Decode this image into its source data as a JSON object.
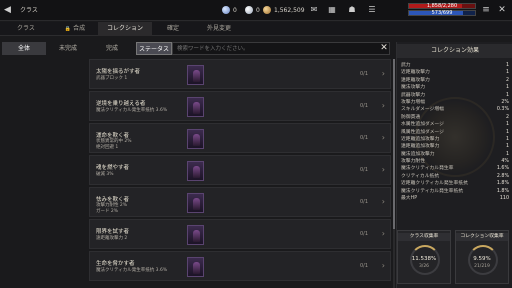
{
  "header": {
    "title": "クラス",
    "currency": [
      "0",
      "0",
      "1,562,509"
    ],
    "hp_text": "1,858/2,280",
    "hp_fraction": 0.81,
    "mp_text": "573/699",
    "mp_fraction": 0.82
  },
  "nav": {
    "tabs": [
      {
        "label": "クラス",
        "active": false
      },
      {
        "label": "合成",
        "active": false,
        "locked": true
      },
      {
        "label": "コレクション",
        "active": true
      },
      {
        "label": "確定",
        "active": false
      },
      {
        "label": "外見変更",
        "active": false
      }
    ]
  },
  "subtabs": {
    "items": [
      {
        "label": "全体",
        "state": "active"
      },
      {
        "label": "未完成",
        "state": ""
      },
      {
        "label": "完成",
        "state": ""
      },
      {
        "label": "ステータス",
        "state": "selected"
      }
    ],
    "search_placeholder": "検索ワードを入力ください。"
  },
  "collections": [
    {
      "title": "太陽を揺るがす者",
      "desc": [
        "武器ブロック 1"
      ],
      "count": "0/1"
    },
    {
      "title": "逆境を乗り越える者",
      "desc": [
        "魔法クリティカル発生率抵抗 3.6%"
      ],
      "count": "0/1"
    },
    {
      "title": "運命を欺く者",
      "desc": [
        "状態異常的中 2%",
        "絶対回避 1"
      ],
      "count": "0/1"
    },
    {
      "title": "魂を燃やす者",
      "desc": [
        "破滅 3%"
      ],
      "count": "0/1"
    },
    {
      "title": "怯みを欺く者",
      "desc": [
        "攻撃力耐性 2%",
        "ガード 2%"
      ],
      "count": "0/1"
    },
    {
      "title": "限界を試す者",
      "desc": [
        "遠距離攻撃力 2"
      ],
      "count": "0/1"
    },
    {
      "title": "生命を脅かす者",
      "desc": [
        "魔法クリティカル発生率抵抗 3.6%"
      ],
      "count": "0/1"
    }
  ],
  "panel": {
    "title": "コレクション効果",
    "stats": [
      {
        "name": "武力",
        "value": "1"
      },
      {
        "name": "近距離攻撃力",
        "value": "1"
      },
      {
        "name": "遠距離攻撃力",
        "value": "2"
      },
      {
        "name": "魔法攻撃力",
        "value": "1"
      },
      {
        "name": "武器攻撃力",
        "value": "1"
      },
      {
        "name": "攻撃力増幅",
        "value": "2%"
      },
      {
        "name": "スキルダメージ増幅",
        "value": "0.3%"
      },
      {
        "name": "防御貫通",
        "value": "2"
      },
      {
        "name": "水属性追加ダメージ",
        "value": "1"
      },
      {
        "name": "風属性追加ダメージ",
        "value": "1"
      },
      {
        "name": "近距離追加攻撃力",
        "value": "1"
      },
      {
        "name": "遠距離追加攻撃力",
        "value": "1"
      },
      {
        "name": "魔法追加攻撃力",
        "value": "1"
      },
      {
        "name": "攻撃力耐性",
        "value": "4%"
      },
      {
        "name": "魔法クリティカル発生率",
        "value": "1.6%"
      },
      {
        "name": "クリティカル抵抗",
        "value": "2.8%"
      },
      {
        "name": "近距離クリティカル発生率抵抗",
        "value": "1.8%"
      },
      {
        "name": "魔法クリティカル発生率抵抗",
        "value": "1.8%"
      },
      {
        "name": "最大HP",
        "value": "110"
      }
    ],
    "class_rate": {
      "label": "クラス収集率",
      "percent": "11.538%",
      "fraction": "3/26"
    },
    "collection_rate": {
      "label": "コレクション収集率",
      "percent": "9.59%",
      "fraction": "21/219"
    }
  }
}
